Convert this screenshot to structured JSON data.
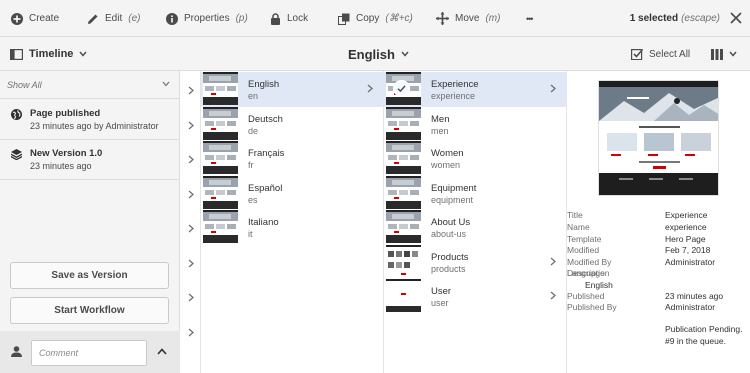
{
  "toolbar": {
    "create": "Create",
    "edit": "Edit",
    "edit_hint": "(e)",
    "properties": "Properties",
    "properties_hint": "(p)",
    "lock": "Lock",
    "copy": "Copy",
    "copy_hint": "(⌘+c)",
    "move": "Move",
    "move_hint": "(m)",
    "more": "•••",
    "selected": "1 selected",
    "selected_hint": "(escape)"
  },
  "header": {
    "rail_title": "Timeline",
    "page_title": "English",
    "select_all": "Select All"
  },
  "timeline": {
    "filter": "Show All",
    "events": [
      {
        "title": "Page published",
        "sub": "23 minutes ago by Administrator"
      },
      {
        "title": "New Version 1.0",
        "sub": "23 minutes ago"
      }
    ],
    "save_version": "Save as Version",
    "start_workflow": "Start Workflow",
    "comment_placeholder": "Comment"
  },
  "column1": [
    {
      "title": "English",
      "name": "en"
    },
    {
      "title": "Deutsch",
      "name": "de"
    },
    {
      "title": "Français",
      "name": "fr"
    },
    {
      "title": "Español",
      "name": "es"
    },
    {
      "title": "Italiano",
      "name": "it"
    }
  ],
  "column2": [
    {
      "title": "Experience",
      "name": "experience"
    },
    {
      "title": "Men",
      "name": "men"
    },
    {
      "title": "Women",
      "name": "women"
    },
    {
      "title": "Equipment",
      "name": "equipment"
    },
    {
      "title": "About Us",
      "name": "about-us"
    },
    {
      "title": "Products",
      "name": "products"
    },
    {
      "title": "User",
      "name": "user"
    }
  ],
  "details": {
    "title_label": "Title",
    "title_value": "Experience",
    "name_label": "Name",
    "name_value": "experience",
    "template_label": "Template",
    "template_value": "Hero Page",
    "modified_label": "Modified",
    "modified_value": "Feb 7, 2018",
    "modified_by_label": "Modified By",
    "modified_by_value": "Administrator",
    "description_label": "Description",
    "language_label": "Language",
    "language_value": "English",
    "published_label": "Published",
    "published_value": "23 minutes ago",
    "published_by_label": "Published By",
    "published_by_value": "Administrator",
    "status_line1": "Publication Pending.",
    "status_line2": "#9 in the queue."
  },
  "colors": {
    "accent": "#2680eb",
    "selected_row": "#dfe8f4",
    "brand_red": "#d40000"
  }
}
